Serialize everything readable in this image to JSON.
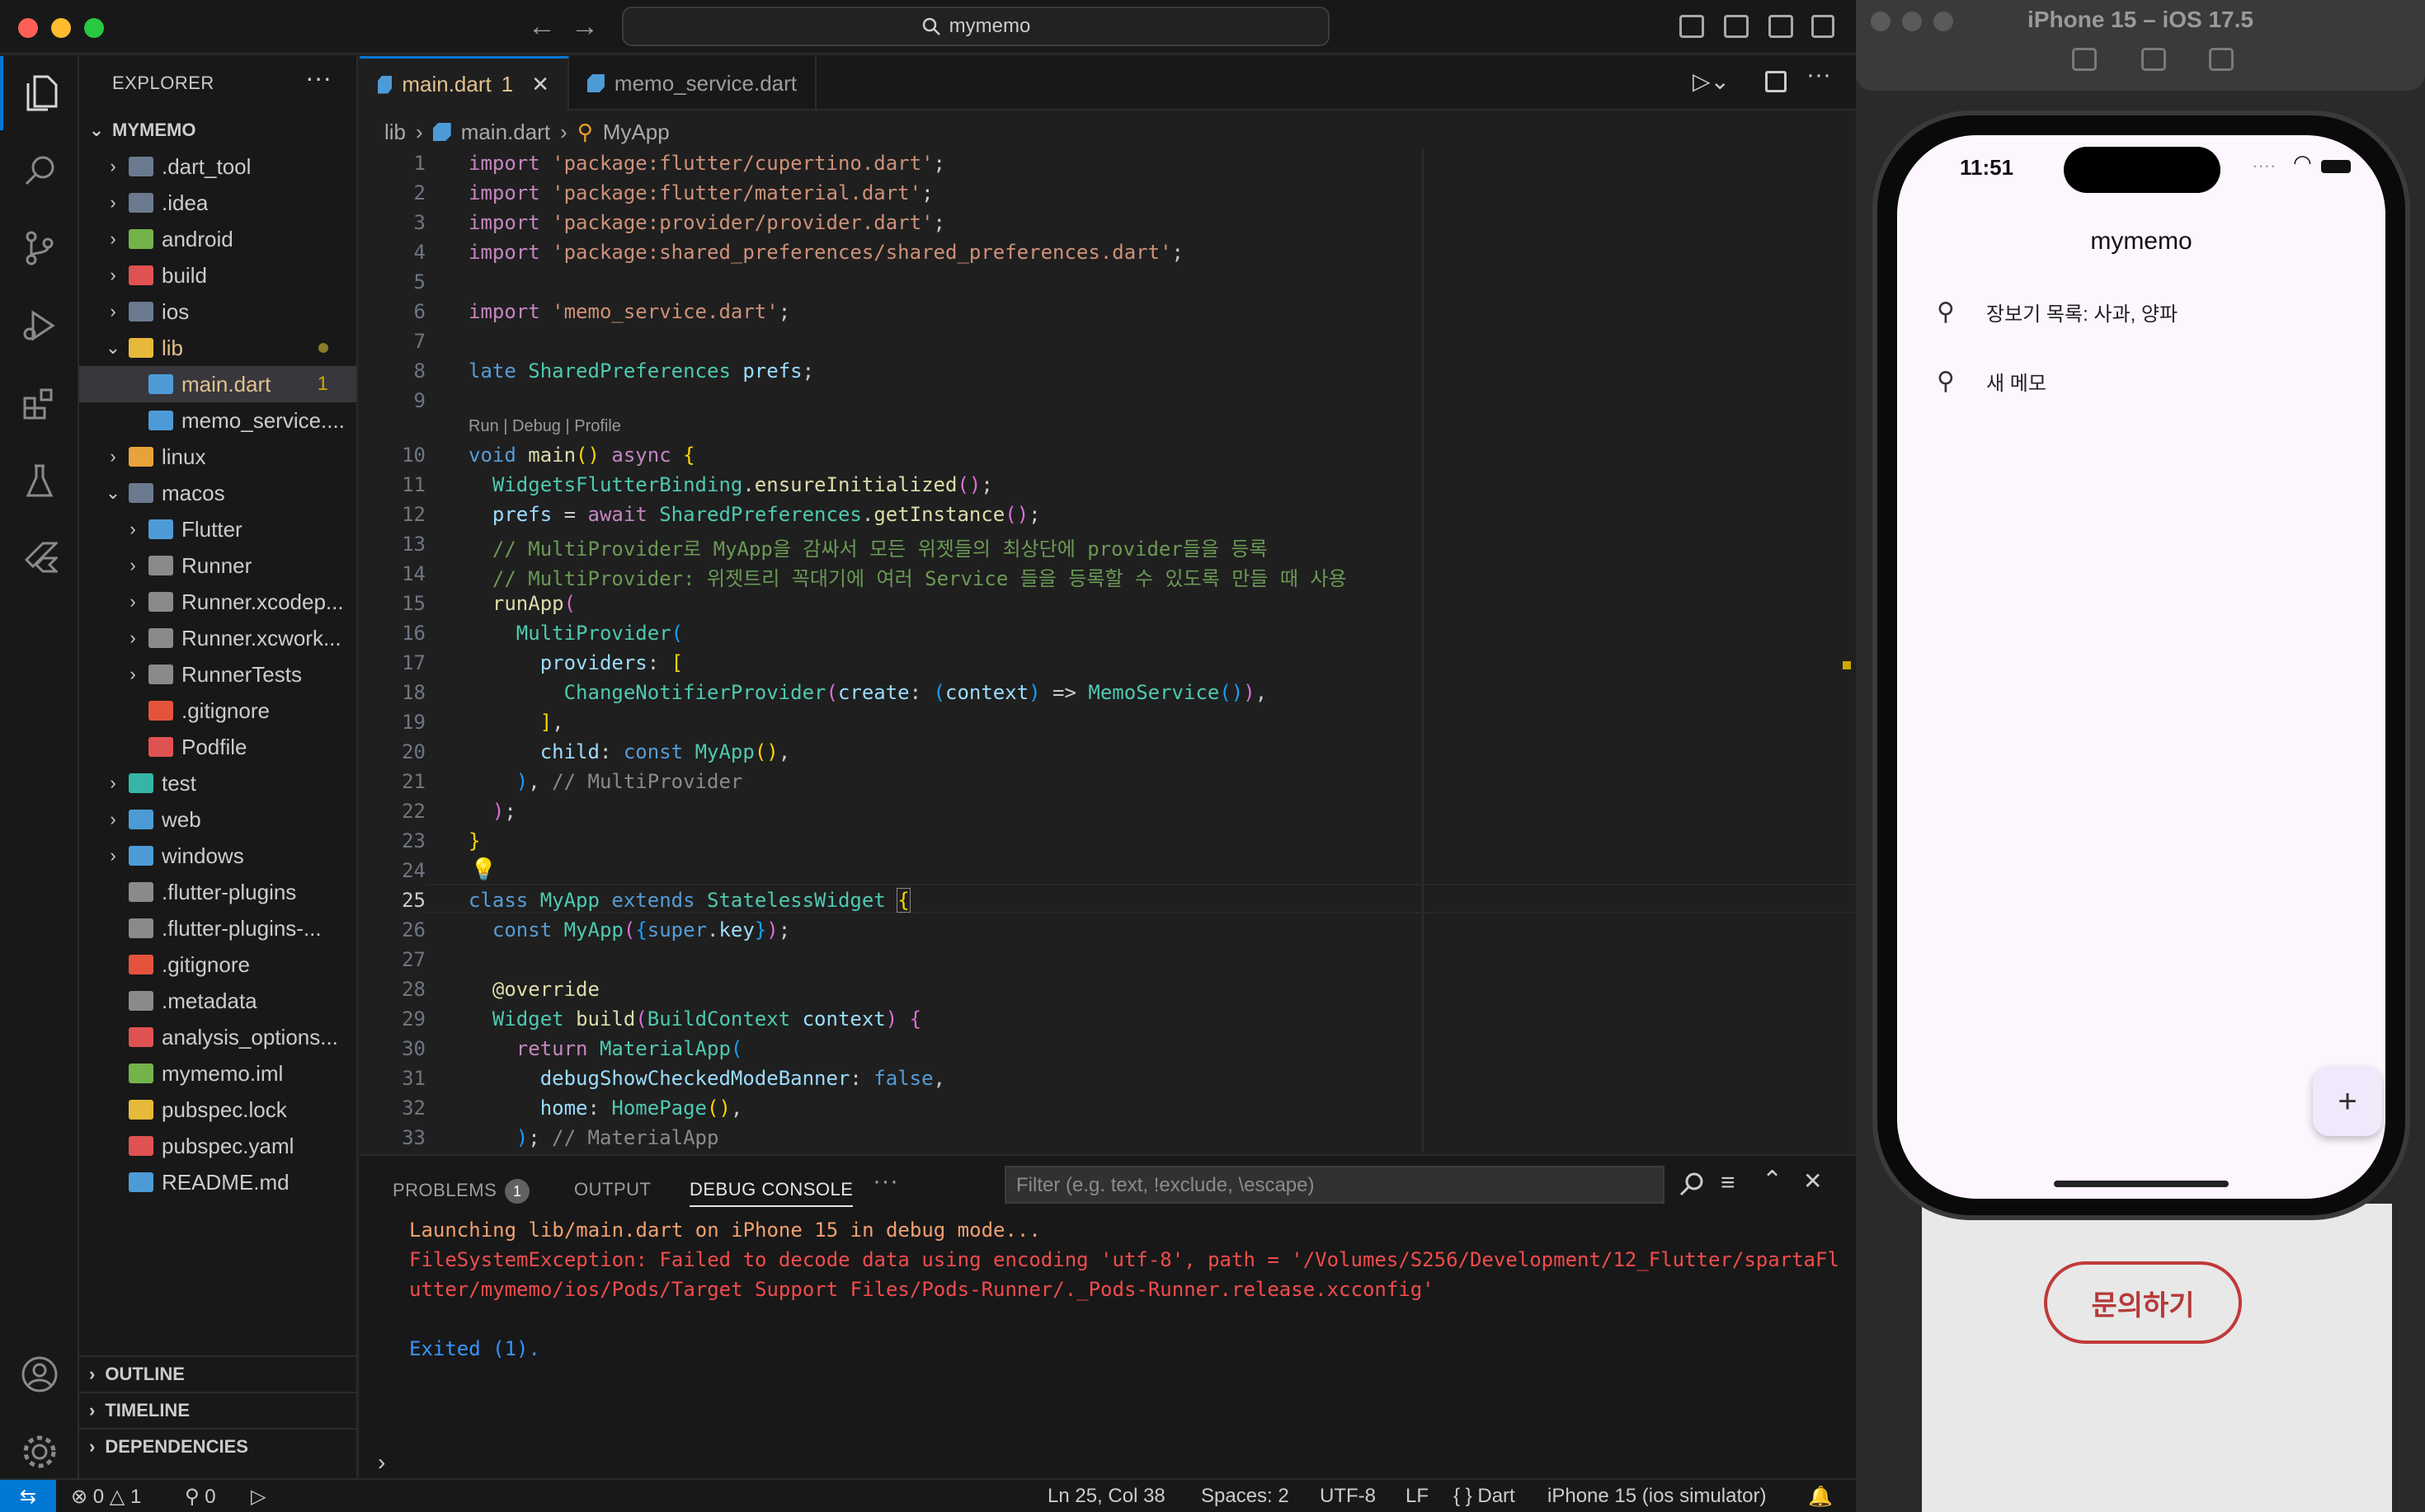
{
  "window": {
    "search": "mymemo"
  },
  "sidebar": {
    "header": "EXPLORER",
    "root": "MYMEMO",
    "items": [
      {
        "label": ".dart_tool",
        "indent": 1,
        "chev": "›",
        "color": "#6b7a8f"
      },
      {
        "label": ".idea",
        "indent": 1,
        "chev": "›",
        "color": "#6b7a8f"
      },
      {
        "label": "android",
        "indent": 1,
        "chev": "›",
        "color": "#74b34a"
      },
      {
        "label": "build",
        "indent": 1,
        "chev": "›",
        "color": "#e05252"
      },
      {
        "label": "ios",
        "indent": 1,
        "chev": "›",
        "color": "#6b7a8f"
      },
      {
        "label": "lib",
        "indent": 1,
        "chev": "⌄",
        "color": "#e7b93a",
        "highlight": true
      },
      {
        "label": "main.dart",
        "indent": 2,
        "chev": "",
        "color": "#4d9bd6",
        "selected": true,
        "badge": "1"
      },
      {
        "label": "memo_service....",
        "indent": 2,
        "chev": "",
        "color": "#4d9bd6"
      },
      {
        "label": "linux",
        "indent": 1,
        "chev": "›",
        "color": "#e7a23a"
      },
      {
        "label": "macos",
        "indent": 1,
        "chev": "⌄",
        "color": "#6b7a8f"
      },
      {
        "label": "Flutter",
        "indent": 2,
        "chev": "›",
        "color": "#4d9bd6"
      },
      {
        "label": "Runner",
        "indent": 2,
        "chev": "›",
        "color": "#8a8a8a"
      },
      {
        "label": "Runner.xcodep...",
        "indent": 2,
        "chev": "›",
        "color": "#8a8a8a"
      },
      {
        "label": "Runner.xcwork...",
        "indent": 2,
        "chev": "›",
        "color": "#8a8a8a"
      },
      {
        "label": "RunnerTests",
        "indent": 2,
        "chev": "›",
        "color": "#8a8a8a"
      },
      {
        "label": ".gitignore",
        "indent": 2,
        "chev": "",
        "color": "#e5533d"
      },
      {
        "label": "Podfile",
        "indent": 2,
        "chev": "",
        "color": "#e05252"
      },
      {
        "label": "test",
        "indent": 1,
        "chev": "›",
        "color": "#36b5a7"
      },
      {
        "label": "web",
        "indent": 1,
        "chev": "›",
        "color": "#4d9bd6"
      },
      {
        "label": "windows",
        "indent": 1,
        "chev": "›",
        "color": "#4d9bd6"
      },
      {
        "label": ".flutter-plugins",
        "indent": 1,
        "chev": "",
        "color": "#8a8a8a"
      },
      {
        "label": ".flutter-plugins-...",
        "indent": 1,
        "chev": "",
        "color": "#8a8a8a"
      },
      {
        "label": ".gitignore",
        "indent": 1,
        "chev": "",
        "color": "#e5533d"
      },
      {
        "label": ".metadata",
        "indent": 1,
        "chev": "",
        "color": "#8a8a8a"
      },
      {
        "label": "analysis_options...",
        "indent": 1,
        "chev": "",
        "color": "#e05252"
      },
      {
        "label": "mymemo.iml",
        "indent": 1,
        "chev": "",
        "color": "#74b34a"
      },
      {
        "label": "pubspec.lock",
        "indent": 1,
        "chev": "",
        "color": "#e7b93a"
      },
      {
        "label": "pubspec.yaml",
        "indent": 1,
        "chev": "",
        "color": "#e05252"
      },
      {
        "label": "README.md",
        "indent": 1,
        "chev": "",
        "color": "#4d9bd6"
      }
    ],
    "sections": [
      "OUTLINE",
      "TIMELINE",
      "DEPENDENCIES"
    ]
  },
  "tabs": [
    {
      "label": "main.dart",
      "badge": "1"
    },
    {
      "label": "memo_service.dart"
    }
  ],
  "breadcrumb": [
    "lib",
    "main.dart",
    "MyApp"
  ],
  "editor": {
    "codelens": "Run | Debug | Profile",
    "current_line": 25
  },
  "panel": {
    "tabs": [
      "PROBLEMS",
      "OUTPUT",
      "DEBUG CONSOLE"
    ],
    "problems_count": "1",
    "filter_placeholder": "Filter (e.g. text, !exclude, \\escape)",
    "lines": [
      {
        "text": "Launching lib/main.dart on iPhone 15 in debug mode...",
        "kind": "warn"
      },
      {
        "text": "FileSystemException: Failed to decode data using encoding 'utf-8', path = '/Volumes/S256/Development/12_Flutter/spartaFl",
        "kind": "err"
      },
      {
        "text": "utter/mymemo/ios/Pods/Target Support Files/Pods-Runner/._Pods-Runner.release.xcconfig'",
        "kind": "err"
      },
      {
        "text": "",
        "kind": "info"
      },
      {
        "text": "Exited (1).",
        "kind": "info"
      }
    ]
  },
  "statusbar": {
    "errors": "0",
    "warnings": "1",
    "ports": "0",
    "position": "Ln 25, Col 38",
    "spaces": "Spaces: 2",
    "encoding": "UTF-8",
    "eol": "LF",
    "language": "Dart",
    "device": "iPhone 15 (ios simulator)"
  },
  "simulator": {
    "title": "iPhone 15 – iOS 17.5",
    "time": "11:51",
    "app_title": "mymemo",
    "memos": [
      "장보기 목록: 사과, 양파",
      "새 메모"
    ],
    "fab": "+",
    "background_button": "문의하기"
  }
}
